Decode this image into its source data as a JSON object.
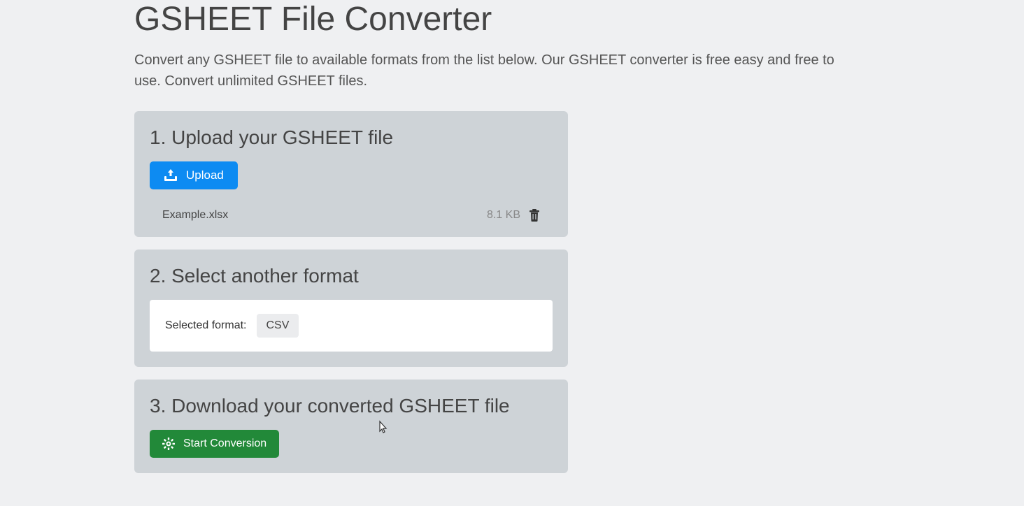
{
  "header": {
    "title": "GSHEET File Converter",
    "description": "Convert any GSHEET file to available formats from the list below. Our GSHEET converter is free easy and free to use. Convert unlimited GSHEET files."
  },
  "step1": {
    "title": "1. Upload your GSHEET file",
    "upload_label": "Upload",
    "file": {
      "name": "Example.xlsx",
      "size": "8.1 KB"
    }
  },
  "step2": {
    "title": "2. Select another format",
    "selected_label": "Selected format:",
    "selected_value": "CSV"
  },
  "step3": {
    "title": "3. Download your converted GSHEET file",
    "start_label": "Start Conversion"
  }
}
